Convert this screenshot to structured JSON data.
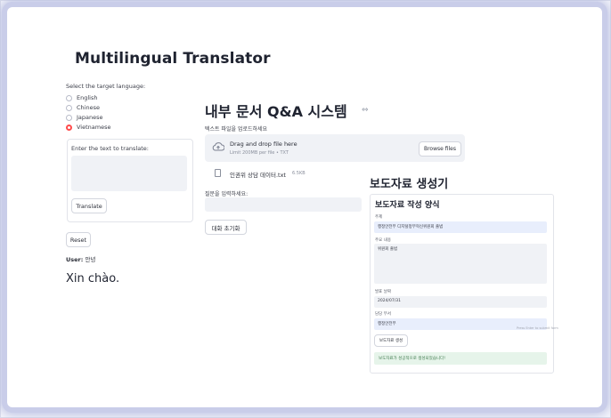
{
  "translator": {
    "title": "Multilingual Translator",
    "language_label": "Select the target language:",
    "languages": [
      "English",
      "Chinese",
      "Japanese",
      "Vietnamese"
    ],
    "selected_language": "Vietnamese",
    "text_label": "Enter the text to translate:",
    "translate_label": "Translate",
    "reset_label": "Reset",
    "user_label": "User:",
    "user_text": "안녕",
    "result": "Xin chào."
  },
  "qa": {
    "title": "내부 문서 Q&A 시스템",
    "upload_label": "텍스트 파일을 업로드하세요",
    "drop_text": "Drag and drop file here",
    "limit_text": "Limit 200MB per file • TXT",
    "browse_label": "Browse files",
    "file_name": "인권위 상담 데이터.txt",
    "file_size": "6.5KB",
    "question_label": "질문을 입력하세요:",
    "reset_chat_label": "대화 초기화"
  },
  "press": {
    "title": "보도자료 생성기",
    "form_title": "보도자료 작성 양식",
    "fields": {
      "subject_label": "주제",
      "subject_value": "행정안전부 디지털정부혁신위원회 출범",
      "content_label": "주요 내용",
      "content_value": "위원회 출범",
      "date_label": "발표 날짜",
      "date_value": "2024/07/31",
      "contact_label": "담당 부서",
      "contact_value": "행정안전부",
      "hint": "Press Enter to submit form"
    },
    "generate_label": "보도자료 생성",
    "success_message": "보도자료가 성공적으로 생성되었습니다!"
  }
}
